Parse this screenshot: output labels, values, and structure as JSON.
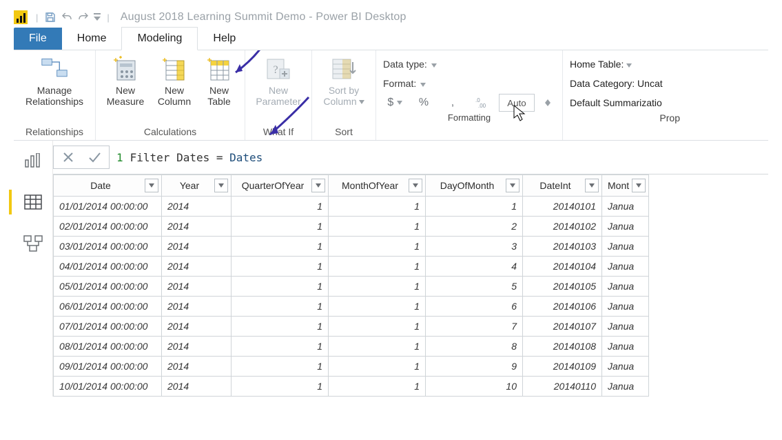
{
  "title_bar": {
    "title": "August 2018 Learning Summit Demo - Power BI Desktop"
  },
  "tabs": {
    "file": "File",
    "home": "Home",
    "modeling": "Modeling",
    "help": "Help"
  },
  "ribbon": {
    "relationships": {
      "manage": "Manage\nRelationships",
      "group_label": "Relationships"
    },
    "calculations": {
      "new_measure": "New\nMeasure",
      "new_column": "New\nColumn",
      "new_table": "New\nTable",
      "group_label": "Calculations"
    },
    "whatif": {
      "new_parameter": "New\nParameter",
      "group_label": "What If"
    },
    "sort": {
      "sort_by_column": "Sort by\nColumn",
      "group_label": "Sort"
    },
    "formatting": {
      "data_type_label": "Data type:",
      "format_label": "Format:",
      "currency": "$",
      "percent": "%",
      "comma": ",",
      "decimal_icon": ".0",
      "auto_value": "Auto",
      "group_label": "Formatting"
    },
    "properties": {
      "home_table": "Home Table:",
      "data_category": "Data Category: Uncat",
      "default_summarization": "Default Summarizatio",
      "group_label": "Prop"
    }
  },
  "formula": {
    "line_number": "1",
    "text_pre": "Filter Dates = ",
    "text_ident": "Dates"
  },
  "table": {
    "columns": [
      "Date",
      "Year",
      "QuarterOfYear",
      "MonthOfYear",
      "DayOfMonth",
      "DateInt",
      "Mont"
    ],
    "rows": [
      {
        "date": "01/01/2014 00:00:00",
        "year": "2014",
        "q": "1",
        "m": "1",
        "d": "1",
        "i": "20140101",
        "mn": "Janua"
      },
      {
        "date": "02/01/2014 00:00:00",
        "year": "2014",
        "q": "1",
        "m": "1",
        "d": "2",
        "i": "20140102",
        "mn": "Janua"
      },
      {
        "date": "03/01/2014 00:00:00",
        "year": "2014",
        "q": "1",
        "m": "1",
        "d": "3",
        "i": "20140103",
        "mn": "Janua"
      },
      {
        "date": "04/01/2014 00:00:00",
        "year": "2014",
        "q": "1",
        "m": "1",
        "d": "4",
        "i": "20140104",
        "mn": "Janua"
      },
      {
        "date": "05/01/2014 00:00:00",
        "year": "2014",
        "q": "1",
        "m": "1",
        "d": "5",
        "i": "20140105",
        "mn": "Janua"
      },
      {
        "date": "06/01/2014 00:00:00",
        "year": "2014",
        "q": "1",
        "m": "1",
        "d": "6",
        "i": "20140106",
        "mn": "Janua"
      },
      {
        "date": "07/01/2014 00:00:00",
        "year": "2014",
        "q": "1",
        "m": "1",
        "d": "7",
        "i": "20140107",
        "mn": "Janua"
      },
      {
        "date": "08/01/2014 00:00:00",
        "year": "2014",
        "q": "1",
        "m": "1",
        "d": "8",
        "i": "20140108",
        "mn": "Janua"
      },
      {
        "date": "09/01/2014 00:00:00",
        "year": "2014",
        "q": "1",
        "m": "1",
        "d": "9",
        "i": "20140109",
        "mn": "Janua"
      },
      {
        "date": "10/01/2014 00:00:00",
        "year": "2014",
        "q": "1",
        "m": "1",
        "d": "10",
        "i": "20140110",
        "mn": "Janua"
      }
    ]
  }
}
